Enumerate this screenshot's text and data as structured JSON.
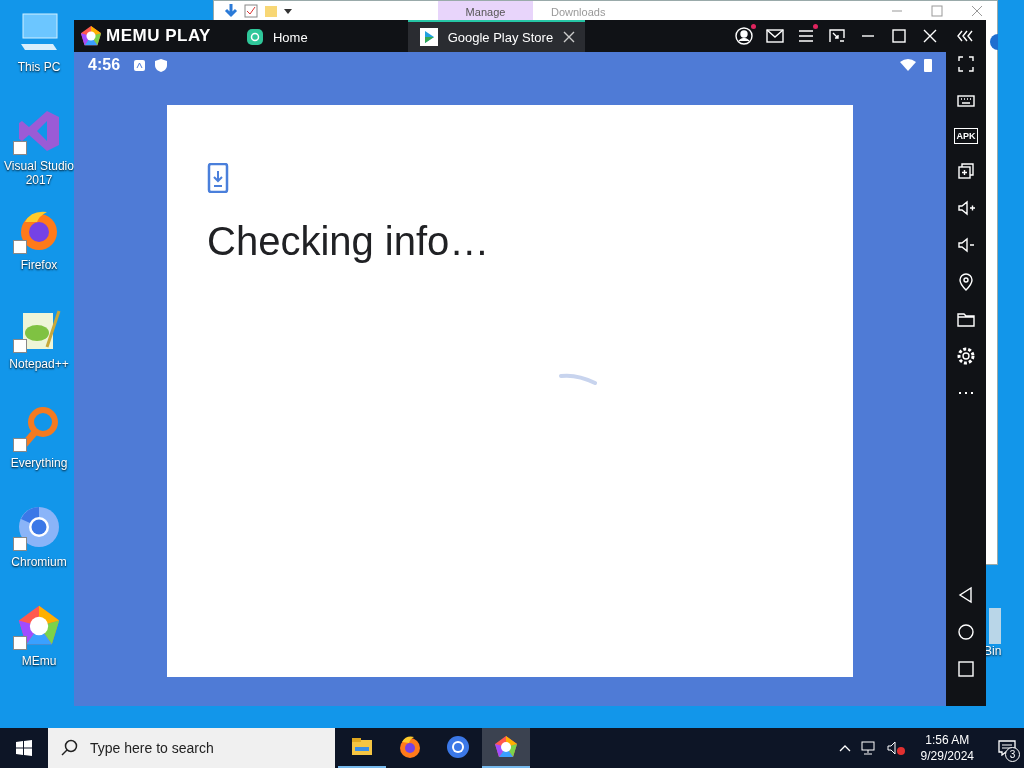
{
  "desktop_icons": [
    {
      "kind": "pc",
      "label": "This PC",
      "shortcut": false
    },
    {
      "kind": "vs",
      "label": "Visual Studio 2017",
      "shortcut": true
    },
    {
      "kind": "firefox",
      "label": "Firefox",
      "shortcut": true
    },
    {
      "kind": "notepad",
      "label": "Notepad++",
      "shortcut": true
    },
    {
      "kind": "everything",
      "label": "Everything",
      "shortcut": true
    },
    {
      "kind": "chromium",
      "label": "Chromium",
      "shortcut": true
    },
    {
      "kind": "memu",
      "label": "MEmu",
      "shortcut": true
    }
  ],
  "recycle_bin": {
    "label": "Bin"
  },
  "background_window": {
    "tabs": [
      {
        "label": "Manage",
        "selected": true
      },
      {
        "label": "Downloads",
        "selected": false
      }
    ]
  },
  "emulator": {
    "logo": "MEMU PLAY",
    "tabs": [
      {
        "kind": "home",
        "label": "Home",
        "selected": false
      },
      {
        "kind": "play",
        "label": "Google Play Store",
        "selected": true
      }
    ],
    "status_bar": {
      "time": "4:56"
    },
    "dialog": {
      "title": "Checking info…"
    },
    "sidebar_apk_label": "APK"
  },
  "taskbar": {
    "search": {
      "placeholder": "Type here to search"
    },
    "apps": [
      {
        "kind": "explorer",
        "running": true,
        "selected": false
      },
      {
        "kind": "firefox",
        "running": false,
        "selected": false
      },
      {
        "kind": "chromium",
        "running": false,
        "selected": false
      },
      {
        "kind": "memu",
        "running": true,
        "selected": true
      }
    ],
    "time": "1:56 AM",
    "date": "9/29/2024",
    "notification_count": "3"
  }
}
